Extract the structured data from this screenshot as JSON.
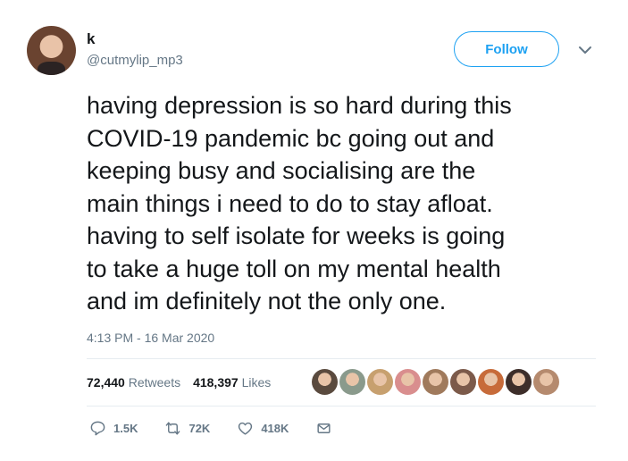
{
  "author": {
    "name": "k",
    "handle": "@cutmylip_mp3"
  },
  "follow_label": "Follow",
  "tweet": {
    "lines": [
      "having depression is so hard during this",
      "COVID-19 pandemic bc going out and",
      "keeping busy and socialising are the",
      "main things i need to do to stay afloat.",
      "having to self isolate for weeks is going",
      "to take a huge toll on my mental health",
      "and im definitely not the only one."
    ],
    "timestamp": "4:13 PM - 16 Mar 2020"
  },
  "stats": {
    "retweets_count": "72,440",
    "retweets_label": "Retweets",
    "likes_count": "418,397",
    "likes_label": "Likes"
  },
  "likers": [
    {
      "color": "#5a4a3e"
    },
    {
      "color": "#8a9a8c"
    },
    {
      "color": "#c7a06f"
    },
    {
      "color": "#d98e8e"
    },
    {
      "color": "#a07a5c"
    },
    {
      "color": "#7c5a4a"
    },
    {
      "color": "#c76b3a"
    },
    {
      "color": "#3d2e2a"
    },
    {
      "color": "#b58a6e"
    }
  ],
  "actions": {
    "replies": "1.5K",
    "retweets": "72K",
    "likes": "418K"
  },
  "icons": {
    "reply": "reply-icon",
    "retweet": "retweet-icon",
    "like": "heart-icon",
    "dm": "envelope-icon",
    "menu": "chevron-down-icon"
  },
  "colors": {
    "accent": "#1da1f2",
    "muted": "#657786",
    "text": "#14171a",
    "divider": "#e6ecf0"
  }
}
